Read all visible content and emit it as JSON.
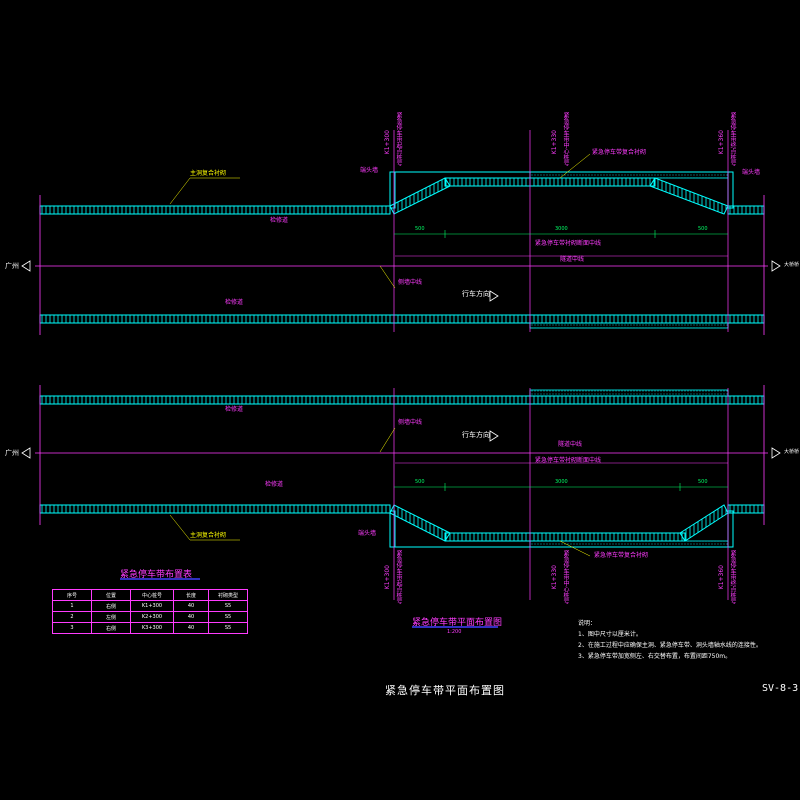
{
  "title": "紧急停车带平面布置图",
  "drawing_number": "SV-8-3",
  "plan_title": "紧急停车带平面布置图",
  "plan_scale": "1:200",
  "colors": {
    "background": "#000000",
    "tunnel": "#00ffff",
    "annotation": "#ff3cff",
    "dimension": "#00ff66",
    "text": "#ffffff"
  },
  "upper_plan": {
    "left_end": "广州",
    "right_end": "大桥桥",
    "labels": {
      "main_lining": "主洞复合衬砌",
      "maintenance_way_top": "检修道",
      "maintenance_way_bottom": "检修道",
      "end_wall_left": "端头墙",
      "end_wall_right": "端头墙",
      "bay_lining": "紧急停车带复合衬砌",
      "bay_centerline": "紧急停车带衬砌断面中线",
      "tunnel_centerline": "隧道中线",
      "lane_centerline": "侧墙中线",
      "travel_direction": "行车方向"
    },
    "stations": [
      "K1+300",
      "K1+330",
      "K1+360"
    ],
    "station_notes": [
      "紧急停车带起点桩号",
      "紧急停车带中心桩号",
      "紧急停车带终点桩号"
    ],
    "dimensions": [
      "500",
      "3000",
      "500"
    ]
  },
  "lower_plan": {
    "left_end": "广州",
    "right_end": "大桥桥",
    "labels": {
      "maintenance_way_top": "检修道",
      "maintenance_way_bottom": "检修道",
      "main_lining": "主洞复合衬砌",
      "end_wall": "端头墙",
      "bay_lining": "紧急停车带复合衬砌",
      "bay_centerline": "紧急停车带衬砌断面中线",
      "tunnel_centerline": "隧道中线",
      "lane_centerline": "侧墙中线",
      "travel_direction": "行车方向"
    },
    "stations": [
      "K1+300",
      "K1+330",
      "K1+360"
    ],
    "station_notes": [
      "紧急停车带起点桩号",
      "紧急停车带中心桩号",
      "紧急停车带终点桩号"
    ],
    "dimensions": [
      "500",
      "3000",
      "500"
    ]
  },
  "layout_table": {
    "title": "紧急停车带布置表",
    "headers": [
      "序号",
      "位置",
      "中心桩号",
      "长度",
      "衬砌类型"
    ],
    "rows": [
      [
        "1",
        "右侧",
        "K1+300",
        "40",
        "S5"
      ],
      [
        "2",
        "左侧",
        "K2+300",
        "40",
        "S5"
      ],
      [
        "3",
        "右侧",
        "K3+300",
        "40",
        "S5"
      ]
    ]
  },
  "notes": {
    "heading": "说明：",
    "items": [
      "1、图中尺寸以厘米计。",
      "2、在施工过程中应确保主洞、紧急停车带、洞头墙轴水线的连接性。",
      "3、紧急停车带加宽侧左、右交替布置，布置间距750m。"
    ]
  }
}
